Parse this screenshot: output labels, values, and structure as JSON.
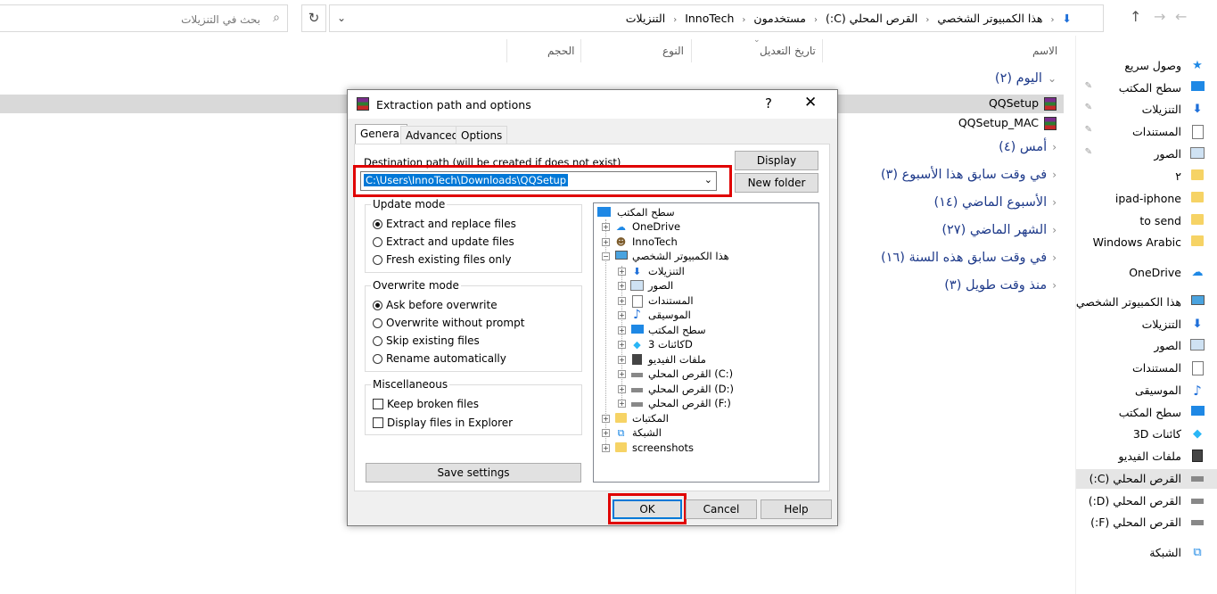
{
  "search": {
    "placeholder": "بحث في التنزيلات"
  },
  "address": {
    "crumbs": [
      "هذا الكمبيوتر الشخصي",
      "القرص المحلي (C:)",
      "مستخدمون",
      "InnoTech",
      "التنزيلات"
    ]
  },
  "columns": {
    "name": "الاسم",
    "date": "تاريخ التعديل",
    "type": "النوع",
    "size": "الحجم"
  },
  "groups": [
    {
      "label": "اليوم (٢)"
    },
    {
      "label": "أمس (٤)"
    },
    {
      "label": "في وقت سابق هذا الأسبوع (٣)"
    },
    {
      "label": "الأسبوع الماضي (١٤)"
    },
    {
      "label": "الشهر الماضي (٢٧)"
    },
    {
      "label": "في وقت سابق هذه السنة (١٦)"
    },
    {
      "label": "منذ وقت طويل (٣)"
    }
  ],
  "files": [
    {
      "name": "QQSetup"
    },
    {
      "name": "QQSetup_MAC"
    }
  ],
  "sidebar": {
    "items": [
      {
        "label": "وصول سريع",
        "icon": "star-icon"
      },
      {
        "label": "سطح المكتب",
        "icon": "desktop-icon"
      },
      {
        "label": "التنزيلات",
        "icon": "download-icon"
      },
      {
        "label": "المستندات",
        "icon": "documents-icon"
      },
      {
        "label": "الصور",
        "icon": "pictures-icon"
      },
      {
        "label": "٢",
        "icon": "folder-icon"
      },
      {
        "label": "ipad-iphone",
        "icon": "folder-icon"
      },
      {
        "label": "to send",
        "icon": "folder-icon"
      },
      {
        "label": "Windows Arabic",
        "icon": "folder-icon"
      },
      {
        "label": "OneDrive",
        "icon": "cloud-icon"
      },
      {
        "label": "هذا الكمبيوتر الشخصي",
        "icon": "computer-icon"
      },
      {
        "label": "التنزيلات",
        "icon": "download-icon"
      },
      {
        "label": "الصور",
        "icon": "pictures-icon"
      },
      {
        "label": "المستندات",
        "icon": "documents-icon"
      },
      {
        "label": "الموسيقى",
        "icon": "music-icon"
      },
      {
        "label": "سطح المكتب",
        "icon": "desktop-icon"
      },
      {
        "label": "كائنات 3D",
        "icon": "3d-objects-icon"
      },
      {
        "label": "ملفات الفيديو",
        "icon": "video-icon"
      },
      {
        "label": "القرص المحلي (C:)",
        "icon": "drive-icon"
      },
      {
        "label": "القرص المحلي (D:)",
        "icon": "drive-icon"
      },
      {
        "label": "القرص المحلي (F:)",
        "icon": "drive-icon"
      },
      {
        "label": "الشبكة",
        "icon": "network-icon"
      }
    ]
  },
  "dialog": {
    "title": "Extraction path and options",
    "help": "?",
    "close": "✕",
    "tabs": [
      "General",
      "Advanced",
      "Options"
    ],
    "dest_label": "Destination path (will be created if does not exist)",
    "dest_value": "C:\\Users\\InnoTech\\Downloads\\QQSetup",
    "display_btn": "Display",
    "newfolder_btn": "New folder",
    "update_mode": {
      "legend": "Update mode",
      "options": [
        "Extract and replace files",
        "Extract and update files",
        "Fresh existing files only"
      ],
      "selected": 0
    },
    "overwrite_mode": {
      "legend": "Overwrite mode",
      "options": [
        "Ask before overwrite",
        "Overwrite without prompt",
        "Skip existing files",
        "Rename automatically"
      ],
      "selected": 0
    },
    "misc": {
      "legend": "Miscellaneous",
      "options": [
        "Keep broken files",
        "Display files in Explorer"
      ]
    },
    "save_settings": "Save settings",
    "tree": [
      {
        "label": "سطح المكتب",
        "icon": "desktop-icon"
      },
      {
        "label": "OneDrive",
        "icon": "cloud-icon"
      },
      {
        "label": "InnoTech",
        "icon": "user-icon"
      },
      {
        "label": "هذا الكمبيوتر الشخصي",
        "icon": "computer-icon"
      },
      {
        "label": "التنزيلات",
        "icon": "download-icon"
      },
      {
        "label": "الصور",
        "icon": "pictures-icon"
      },
      {
        "label": "المستندات",
        "icon": "documents-icon"
      },
      {
        "label": "الموسيقى",
        "icon": "music-icon"
      },
      {
        "label": "سطح المكتب",
        "icon": "desktop-icon"
      },
      {
        "label": "كائنات 3D",
        "icon": "3d-objects-icon"
      },
      {
        "label": "ملفات الفيديو",
        "icon": "video-icon"
      },
      {
        "label": "القرص المحلي (C:)",
        "icon": "drive-icon"
      },
      {
        "label": "القرص المحلي (D:)",
        "icon": "drive-icon"
      },
      {
        "label": "القرص المحلي (F:)",
        "icon": "drive-icon"
      },
      {
        "label": "المكتبات",
        "icon": "libraries-icon"
      },
      {
        "label": "الشبكة",
        "icon": "network-icon"
      },
      {
        "label": "screenshots",
        "icon": "folder-icon"
      }
    ],
    "ok": "OK",
    "cancel": "Cancel",
    "helpbtn": "Help"
  }
}
